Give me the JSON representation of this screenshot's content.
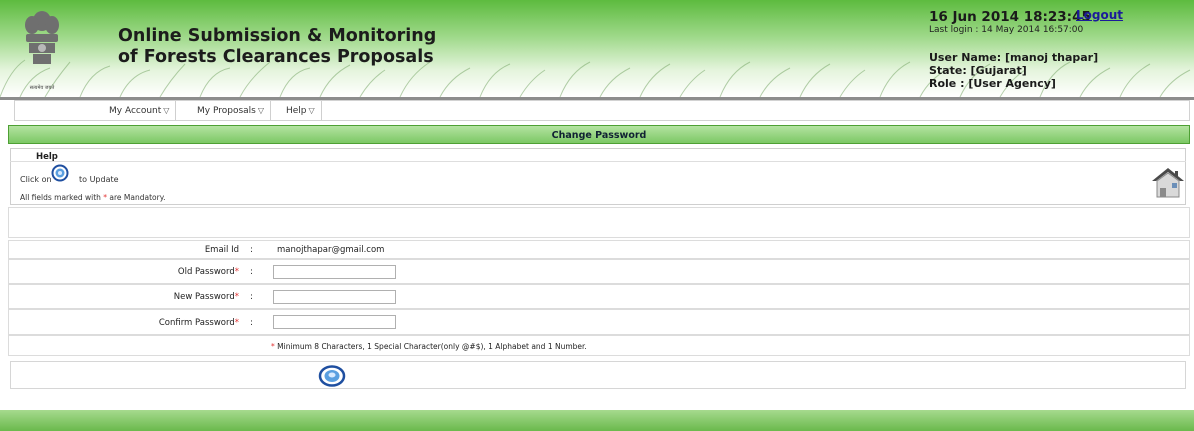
{
  "header": {
    "title_line1": "Online Submission & Monitoring",
    "title_line2": "of Forests Clearances Proposals",
    "emblem_caption": "सत्यमेव जयते",
    "datetime": "16 Jun 2014 18:23:45",
    "logout_label": "Logout",
    "last_login": "Last login : 14 May 2014 16:57:00",
    "user_name": "User Name: [manoj thapar]",
    "state": "State: [Gujarat]",
    "role": "Role : [User Agency]"
  },
  "menu": {
    "items": [
      {
        "label": "My Account",
        "arrow": "▽"
      },
      {
        "label": "My Proposals",
        "arrow": "▽"
      },
      {
        "label": "Help",
        "arrow": "▽"
      }
    ]
  },
  "section_title": "Change Password",
  "help": {
    "title": "Help",
    "click_on": "Click on",
    "to_update": "to Update",
    "mandatory_prefix": "All fields marked with",
    "mandatory_star": "*",
    "mandatory_suffix": "are Mandatory."
  },
  "form": {
    "email_label": "Email Id",
    "email_colon": ":",
    "email_value": "manojthapar@gmail.com",
    "old_password_label": "Old Password",
    "new_password_label": "New Password",
    "confirm_password_label": "Confirm Password",
    "required_mark": "*",
    "colon": ":",
    "old_password_value": "",
    "new_password_value": "",
    "confirm_password_value": "",
    "note_star": "*",
    "note_text": "Minimum 8 Characters, 1 Special Character(only @#$), 1 Alphabet and 1 Number."
  },
  "colors": {
    "header_green": "#5dbb3f",
    "section_green": "#7cc865",
    "required_red": "#e23232",
    "link_blue": "#1b1b9a"
  },
  "icons": {
    "update": "update-icon",
    "home": "home-icon",
    "emblem": "emblem-icon"
  }
}
